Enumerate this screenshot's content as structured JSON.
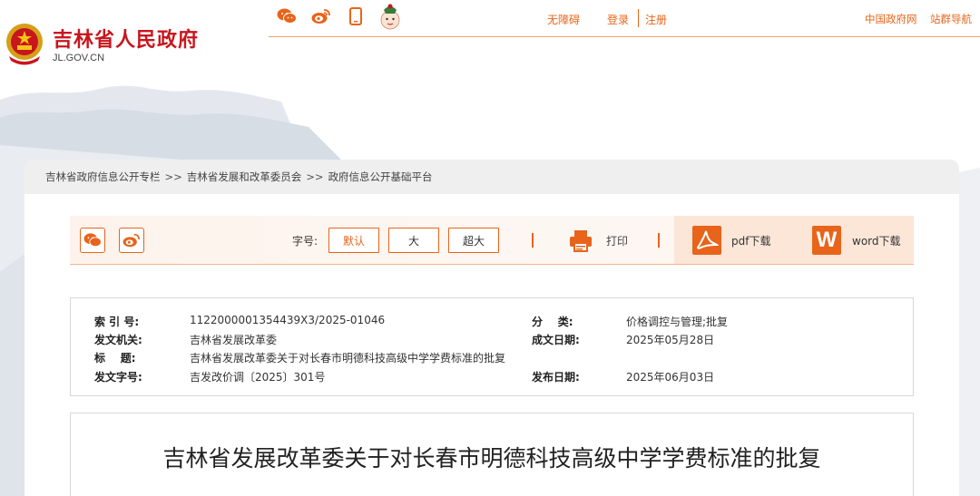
{
  "header": {
    "site_title": "吉林省人民政府",
    "site_domain": "JL.GOV.CN",
    "top_links": {
      "accessibility": "无障碍",
      "login": "登录",
      "register": "注册",
      "china_gov": "中国政府网",
      "site_nav": "站群导航"
    },
    "icons": [
      "wechat-icon",
      "weibo-icon",
      "mobile-icon",
      "mascot-icon"
    ]
  },
  "breadcrumb": {
    "items": [
      "吉林省政府信息公开专栏",
      "吉林省发展和改革委员会",
      "政府信息公开基础平台"
    ],
    "separator": ">>"
  },
  "toolbar": {
    "font_size_label": "字号:",
    "font_sizes": [
      "默认",
      "大",
      "超大"
    ],
    "print_label": "打印",
    "pdf_label": "pdf下载",
    "word_label": "word下载",
    "word_letter": "W"
  },
  "meta": {
    "index_label": "索 引 号:",
    "index_value": "1122000001354439X3/2025-01046",
    "category_label": "分    类:",
    "category_value": "价格调控与管理;批复",
    "issuer_label": "发文机关:",
    "issuer_value": "吉林省发展改革委",
    "created_label": "成文日期:",
    "created_value": "2025年05月28日",
    "title_label": "标    题:",
    "title_value": "吉林省发展改革委关于对长春市明德科技高级中学学费标准的批复",
    "docno_label": "发文字号:",
    "docno_value": "吉发改价调〔2025〕301号",
    "published_label": "发布日期:",
    "published_value": "2025年06月03日"
  },
  "article": {
    "title": "吉林省发展改革委关于对长春市明德科技高级中学学费标准的批复"
  },
  "colors": {
    "brand_red": "#c8161d",
    "accent_orange": "#e8641b"
  }
}
